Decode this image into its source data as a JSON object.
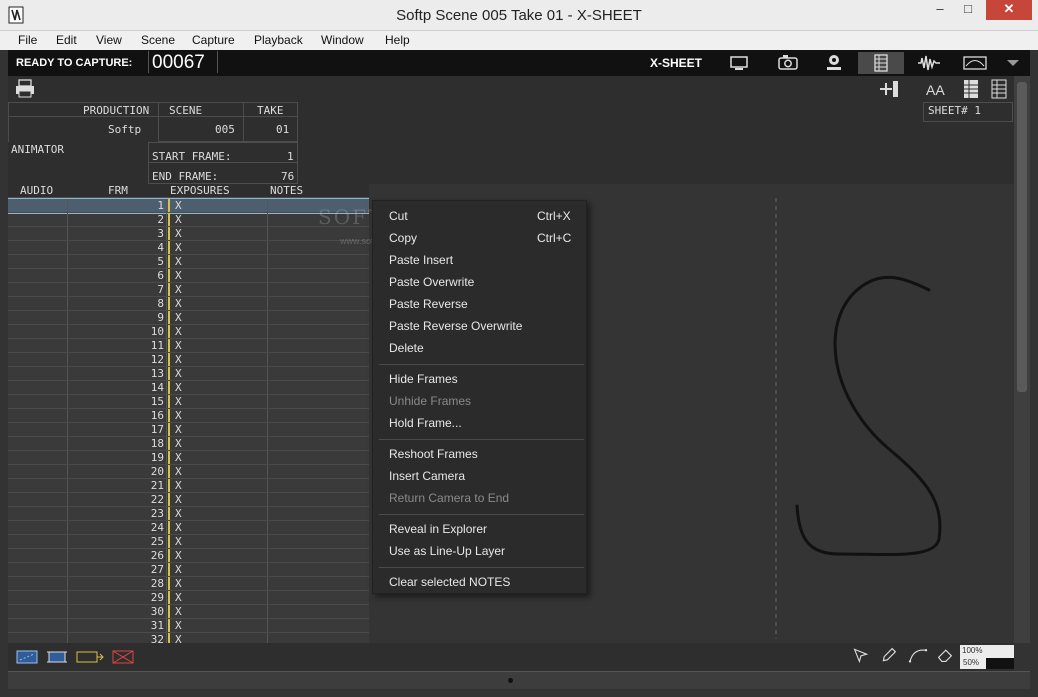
{
  "window": {
    "title": "Softp  Scene 005  Take 01 - X-SHEET",
    "minimize_glyph": "–",
    "maximize_glyph": "□",
    "close_glyph": "✕"
  },
  "menu": [
    "File",
    "Edit",
    "View",
    "Scene",
    "Capture",
    "Playback",
    "Window",
    "Help"
  ],
  "toolbar": {
    "status_label": "READY TO CAPTURE:",
    "frame_counter": "00067",
    "mode_label": "X-SHEET",
    "icons": [
      "monitor-icon",
      "camera-icon",
      "webcam-icon",
      "xsheet-icon",
      "audio-wave-icon",
      "timeline-icon",
      "dropdown-arrow-icon"
    ]
  },
  "subbar": {
    "print_icon": "printer-icon",
    "add_icon": "add-column-icon",
    "font_size_label": "AA",
    "sheet_label": "SHEET# 1"
  },
  "header": {
    "production_label": "PRODUCTION",
    "production_value": "Softp",
    "scene_label": "SCENE",
    "scene_value": "005",
    "take_label": "TAKE",
    "take_value": "01",
    "animator_label": "ANIMATOR",
    "start_frame_label": "START FRAME:",
    "start_frame_value": "1",
    "end_frame_label": "END FRAME:",
    "end_frame_value": "76"
  },
  "grid": {
    "columns": [
      "AUDIO",
      "FRM",
      "EXPOSURES",
      "NOTES"
    ],
    "rows": [
      {
        "frm": "1",
        "exp": "X"
      },
      {
        "frm": "2",
        "exp": "X"
      },
      {
        "frm": "3",
        "exp": "X"
      },
      {
        "frm": "4",
        "exp": "X"
      },
      {
        "frm": "5",
        "exp": "X"
      },
      {
        "frm": "6",
        "exp": "X"
      },
      {
        "frm": "7",
        "exp": "X"
      },
      {
        "frm": "8",
        "exp": "X"
      },
      {
        "frm": "9",
        "exp": "X"
      },
      {
        "frm": "10",
        "exp": "X"
      },
      {
        "frm": "11",
        "exp": "X"
      },
      {
        "frm": "12",
        "exp": "X"
      },
      {
        "frm": "13",
        "exp": "X"
      },
      {
        "frm": "14",
        "exp": "X"
      },
      {
        "frm": "15",
        "exp": "X"
      },
      {
        "frm": "16",
        "exp": "X"
      },
      {
        "frm": "17",
        "exp": "X"
      },
      {
        "frm": "18",
        "exp": "X"
      },
      {
        "frm": "19",
        "exp": "X"
      },
      {
        "frm": "20",
        "exp": "X"
      },
      {
        "frm": "21",
        "exp": "X"
      },
      {
        "frm": "22",
        "exp": "X"
      },
      {
        "frm": "23",
        "exp": "X"
      },
      {
        "frm": "24",
        "exp": "X"
      },
      {
        "frm": "25",
        "exp": "X"
      },
      {
        "frm": "26",
        "exp": "X"
      },
      {
        "frm": "27",
        "exp": "X"
      },
      {
        "frm": "28",
        "exp": "X"
      },
      {
        "frm": "29",
        "exp": "X"
      },
      {
        "frm": "30",
        "exp": "X"
      },
      {
        "frm": "31",
        "exp": "X"
      },
      {
        "frm": "32",
        "exp": "X"
      }
    ]
  },
  "context_menu": {
    "groups": [
      [
        {
          "label": "Cut",
          "shortcut": "Ctrl+X",
          "enabled": true
        },
        {
          "label": "Copy",
          "shortcut": "Ctrl+C",
          "enabled": true
        },
        {
          "label": "Paste Insert",
          "shortcut": "",
          "enabled": true
        },
        {
          "label": "Paste Overwrite",
          "shortcut": "",
          "enabled": true
        },
        {
          "label": "Paste Reverse",
          "shortcut": "",
          "enabled": true
        },
        {
          "label": "Paste Reverse Overwrite",
          "shortcut": "",
          "enabled": true
        },
        {
          "label": "Delete",
          "shortcut": "",
          "enabled": true
        }
      ],
      [
        {
          "label": "Hide Frames",
          "shortcut": "",
          "enabled": true
        },
        {
          "label": "Unhide Frames",
          "shortcut": "",
          "enabled": false
        },
        {
          "label": "Hold Frame...",
          "shortcut": "",
          "enabled": true
        }
      ],
      [
        {
          "label": "Reshoot Frames",
          "shortcut": "",
          "enabled": true
        },
        {
          "label": "Insert Camera",
          "shortcut": "",
          "enabled": true
        },
        {
          "label": "Return Camera to End",
          "shortcut": "",
          "enabled": false
        }
      ],
      [
        {
          "label": "Reveal in Explorer",
          "shortcut": "",
          "enabled": true
        },
        {
          "label": "Use as Line-Up Layer",
          "shortcut": "",
          "enabled": true
        }
      ],
      [
        {
          "label": "Clear selected NOTES",
          "shortcut": "",
          "enabled": true
        }
      ]
    ]
  },
  "watermark": {
    "text": "SOFTPEDIA",
    "tm": "™",
    "url": "www.softpedia.com"
  },
  "bottom_tools": {
    "left_icons": [
      "select-frames-icon",
      "crop-icon",
      "extend-icon",
      "clear-icon"
    ],
    "right_icons": [
      "arrow-tool-icon",
      "pencil-tool-icon",
      "curve-tool-icon",
      "eraser-tool-icon"
    ],
    "zoom_100": "100%",
    "zoom_50": "50%"
  },
  "colors": {
    "exposure_marker": "#d8c246",
    "selection": "#4d5f6e",
    "close_button": "#c7463a"
  }
}
